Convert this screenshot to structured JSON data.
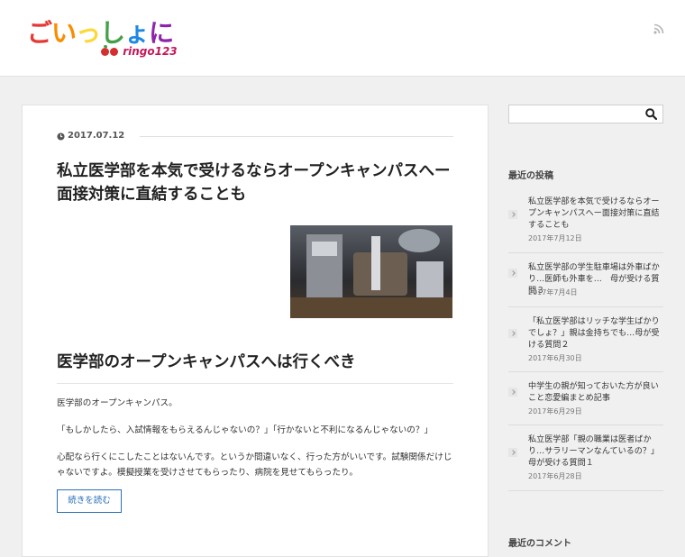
{
  "header": {
    "logo_text": "ごいっしょに",
    "logo_sub": "ringo123",
    "logo_colors": [
      "#e53935",
      "#fb8c00",
      "#fdd835",
      "#43a047",
      "#1e88e5",
      "#8e24aa"
    ],
    "rss_icon": "rss-icon"
  },
  "post": {
    "date": "2017.07.12",
    "title": "私立医学部を本気で受けるならオープンキャンパスへー面接対策に直結することも",
    "section_heading": "医学部のオープンキャンパスへは行くべき",
    "paragraphs": [
      "医学部のオープンキャンパス。",
      "「もしかしたら、入試情報をもらえるんじゃないの？」「行かないと不利になるんじゃないの？」",
      "心配なら行くにこしたことはないんです。というか間違いなく、行った方がいいです。試験関係だけじゃないですよ。模擬授業を受けさせてもらったり、病院を見せてもらったり。"
    ],
    "read_more": "続きを読む"
  },
  "sidebar": {
    "search_placeholder": "",
    "recent_posts_heading": "最近の投稿",
    "recent_comments_heading": "最近のコメント",
    "recent_posts": [
      {
        "title": "私立医学部を本気で受けるならオープンキャンパスへー面接対策に直結することも",
        "date": "2017年7月12日"
      },
      {
        "title": "私立医学部の学生駐車場は外車ばかり…医師も外車を…　母が受ける質問３",
        "date": "2017年7月4日"
      },
      {
        "title": "「私立医学部はリッチな学生ばかりでしょ？」親は金持ちでも…母が受ける質問２",
        "date": "2017年6月30日"
      },
      {
        "title": "中学生の親が知っておいた方が良いこと恋愛編まとめ記事",
        "date": "2017年6月29日"
      },
      {
        "title": "私立医学部「親の職業は医者ばかり…サラリーマンなんているの？」母が受ける質問１",
        "date": "2017年6月28日"
      }
    ]
  }
}
